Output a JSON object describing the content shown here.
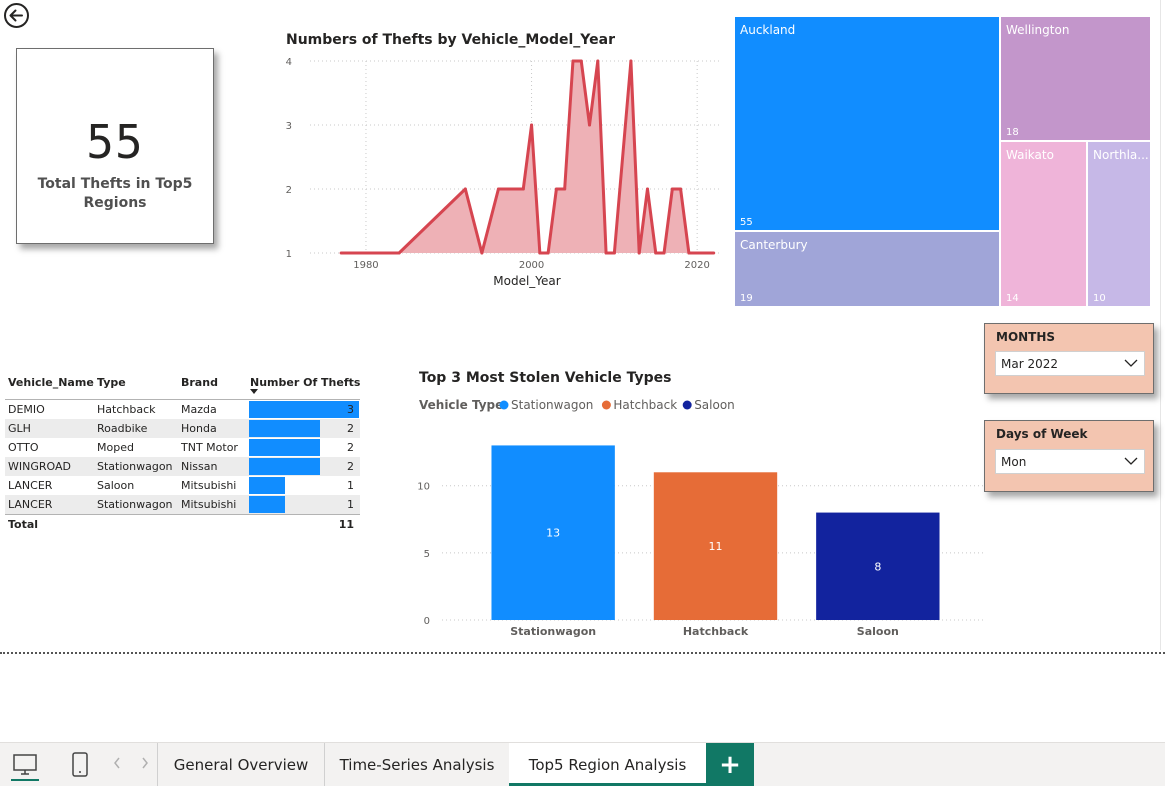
{
  "kpi": {
    "value": "55",
    "label": "Total Thefts in Top5 Regions"
  },
  "area_chart": {
    "title": "Numbers of Thefts by Vehicle_Model_Year",
    "xlabel": "Model_Year",
    "y_ticks": [
      "4",
      "3",
      "2",
      "1"
    ],
    "x_ticks": [
      "1980",
      "2000",
      "2020"
    ]
  },
  "treemap": {
    "cells": [
      {
        "name": "Auckland",
        "value": "55",
        "color": "#118dff"
      },
      {
        "name": "Canterbury",
        "value": "19",
        "color": "#a0a5d8"
      },
      {
        "name": "Wellington",
        "value": "18",
        "color": "#c396cb"
      },
      {
        "name": "Waikato",
        "value": "14",
        "color": "#efb4d9"
      },
      {
        "name": "Northla...",
        "value": "10",
        "color": "#c6b8e7"
      }
    ]
  },
  "table": {
    "headers": [
      "Vehicle_Name",
      "Type",
      "Brand",
      "Number Of Thefts"
    ],
    "rows": [
      {
        "name": "DEMIO",
        "type": "Hatchback",
        "brand": "Mazda",
        "thefts": "3"
      },
      {
        "name": "GLH",
        "type": "Roadbike",
        "brand": "Honda",
        "thefts": "2"
      },
      {
        "name": "OTTO",
        "type": "Moped",
        "brand": "TNT Motor",
        "thefts": "2"
      },
      {
        "name": "WINGROAD",
        "type": "Stationwagon",
        "brand": "Nissan",
        "thefts": "2"
      },
      {
        "name": "LANCER",
        "type": "Saloon",
        "brand": "Mitsubishi",
        "thefts": "1"
      },
      {
        "name": "LANCER",
        "type": "Stationwagon",
        "brand": "Mitsubishi",
        "thefts": "1"
      }
    ],
    "total_label": "Total",
    "total_value": "11"
  },
  "bar_chart": {
    "title": "Top 3 Most Stolen Vehicle Types",
    "legend_title": "Vehicle Type",
    "y_ticks": [
      "10",
      "5",
      "0"
    ]
  },
  "slicers": {
    "months": {
      "title": "MONTHS",
      "value": "Mar 2022"
    },
    "days": {
      "title": "Days of Week",
      "value": "Mon"
    }
  },
  "tabs": {
    "items": [
      {
        "label": "General Overview"
      },
      {
        "label": "Time-Series Analysis"
      },
      {
        "label": "Top5 Region Analysis"
      }
    ],
    "add_label": "+"
  },
  "chart_data": [
    {
      "type": "area",
      "title": "Numbers of Thefts by Vehicle_Model_Year",
      "xlabel": "Model_Year",
      "ylabel": "",
      "xlim": [
        1973,
        2023
      ],
      "ylim": [
        1,
        4
      ],
      "x": [
        1977,
        1984,
        1992,
        1994,
        1996,
        1999,
        2000,
        2001,
        2002,
        2003,
        2004,
        2005,
        2006,
        2007,
        2008,
        2009,
        2010,
        2012,
        2013,
        2014,
        2015,
        2016,
        2017,
        2018,
        2019,
        2020,
        2022
      ],
      "y": [
        1,
        1,
        2,
        1,
        2,
        2,
        3,
        1,
        1,
        2,
        2,
        4,
        4,
        3,
        4,
        1,
        1,
        4,
        1,
        2,
        1,
        1,
        2,
        2,
        1,
        1,
        1
      ],
      "color": "#d64550",
      "fill": "#eeb1b6"
    },
    {
      "type": "bar",
      "title": "Top 3 Most Stolen Vehicle Types",
      "categories": [
        "Stationwagon",
        "Hatchback",
        "Saloon"
      ],
      "values": [
        13,
        11,
        8
      ],
      "colors": [
        "#118dff",
        "#e66c37",
        "#12239e"
      ],
      "legend_title": "Vehicle Type",
      "legend_position": "top-left",
      "ylim": [
        0,
        14
      ],
      "y_ticks": [
        0,
        5,
        10
      ]
    },
    {
      "type": "treemap",
      "categories": [
        "Auckland",
        "Canterbury",
        "Wellington",
        "Waikato",
        "Northla..."
      ],
      "values": [
        55,
        19,
        18,
        14,
        10
      ]
    },
    {
      "type": "table",
      "columns": [
        "Vehicle_Name",
        "Type",
        "Brand",
        "Number Of Thefts"
      ],
      "rows": [
        [
          "DEMIO",
          "Hatchback",
          "Mazda",
          3
        ],
        [
          "GLH",
          "Roadbike",
          "Honda",
          2
        ],
        [
          "OTTO",
          "Moped",
          "TNT Motor",
          2
        ],
        [
          "WINGROAD",
          "Stationwagon",
          "Nissan",
          2
        ],
        [
          "LANCER",
          "Saloon",
          "Mitsubishi",
          1
        ],
        [
          "LANCER",
          "Stationwagon",
          "Mitsubishi",
          1
        ]
      ],
      "total": 11
    }
  ]
}
